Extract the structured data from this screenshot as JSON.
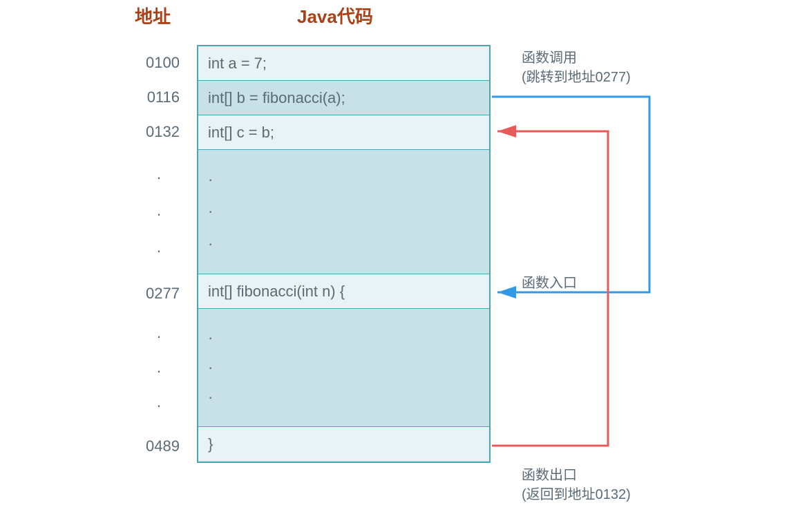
{
  "headers": {
    "address": "地址",
    "code": "Java代码"
  },
  "rows": {
    "r1": {
      "addr": "0100",
      "code": "int a = 7;"
    },
    "r2": {
      "addr": "0116",
      "code": "int[] b = fibonacci(a);"
    },
    "r3": {
      "addr": "0132",
      "code": "int[] c = b;"
    },
    "r4": {
      "addr": "0277",
      "code": "int[] fibonacci(int n) {"
    },
    "r5": {
      "addr": "0489",
      "code": "}"
    }
  },
  "annotations": {
    "call": {
      "line1": "函数调用",
      "line2": "(跳转到地址0277)"
    },
    "entry": "函数入口",
    "exit": {
      "line1": "函数出口",
      "line2": "(返回到地址0132)"
    }
  },
  "colors": {
    "blue": "#3399e6",
    "red": "#e85a5a"
  }
}
